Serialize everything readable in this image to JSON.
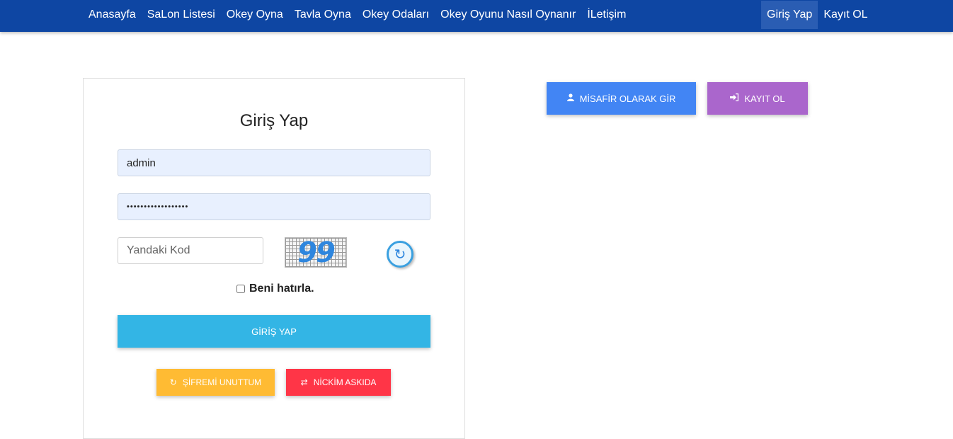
{
  "nav": {
    "items": [
      "Anasayfa",
      "SaLon Listesi",
      "Okey Oyna",
      "Tavla Oyna",
      "Okey Odaları",
      "Okey Oyunu Nasıl Oynanır",
      "İLetişim"
    ],
    "login": "Giriş Yap",
    "register": "Kayıt OL"
  },
  "login_form": {
    "title": "Giriş Yap",
    "username_value": "admin",
    "password_mask": "••••••••••••••••••",
    "captcha_placeholder": "Yandaki Kod",
    "captcha_code": "99",
    "remember_label": "Beni hatırla.",
    "submit_label": "GİRİŞ YAP",
    "forgot_label": "ŞİFREMİ UNUTTUM",
    "nick_label": "NİCKİM ASKIDA"
  },
  "side": {
    "guest_label": "MİSAFİR OLARAK GİR",
    "register_label": "KAYIT OL"
  },
  "icons": {
    "guest": "user-icon",
    "register": "sign-in-icon",
    "forgot": "refresh-icon",
    "nick": "sync-icon",
    "captcha_refresh": "captcha-refresh-icon"
  },
  "colors": {
    "navbar": "#0e46a3",
    "login_button": "#33b5e5",
    "forgot_button": "#ffbb33",
    "nick_button": "#ff3547",
    "guest_button": "#4285f4",
    "register_button": "#aa66cc"
  }
}
